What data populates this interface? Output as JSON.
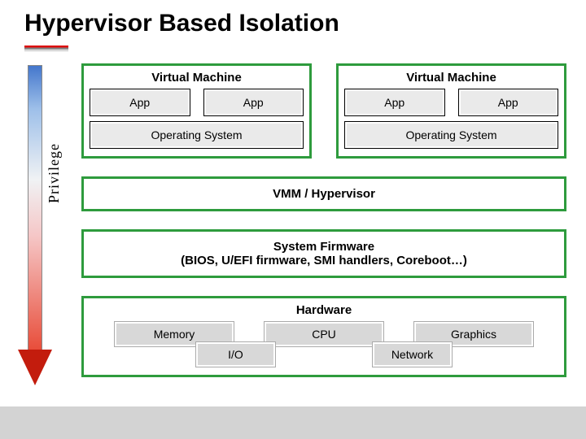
{
  "title": "Hypervisor Based Isolation",
  "privilege_label": "Privilege",
  "vm": {
    "left": {
      "label": "Virtual Machine",
      "apps": [
        "App",
        "App"
      ],
      "os": "Operating System"
    },
    "right": {
      "label": "Virtual Machine",
      "apps": [
        "App",
        "App"
      ],
      "os": "Operating System"
    }
  },
  "vmm_label": "VMM / Hypervisor",
  "firmware_label": "System Firmware\n(BIOS, U/EFI firmware, SMI handlers, Coreboot…)",
  "hardware": {
    "label": "Hardware",
    "row1": [
      "Memory",
      "CPU",
      "Graphics"
    ],
    "row2": [
      "I/O",
      "Network"
    ]
  }
}
